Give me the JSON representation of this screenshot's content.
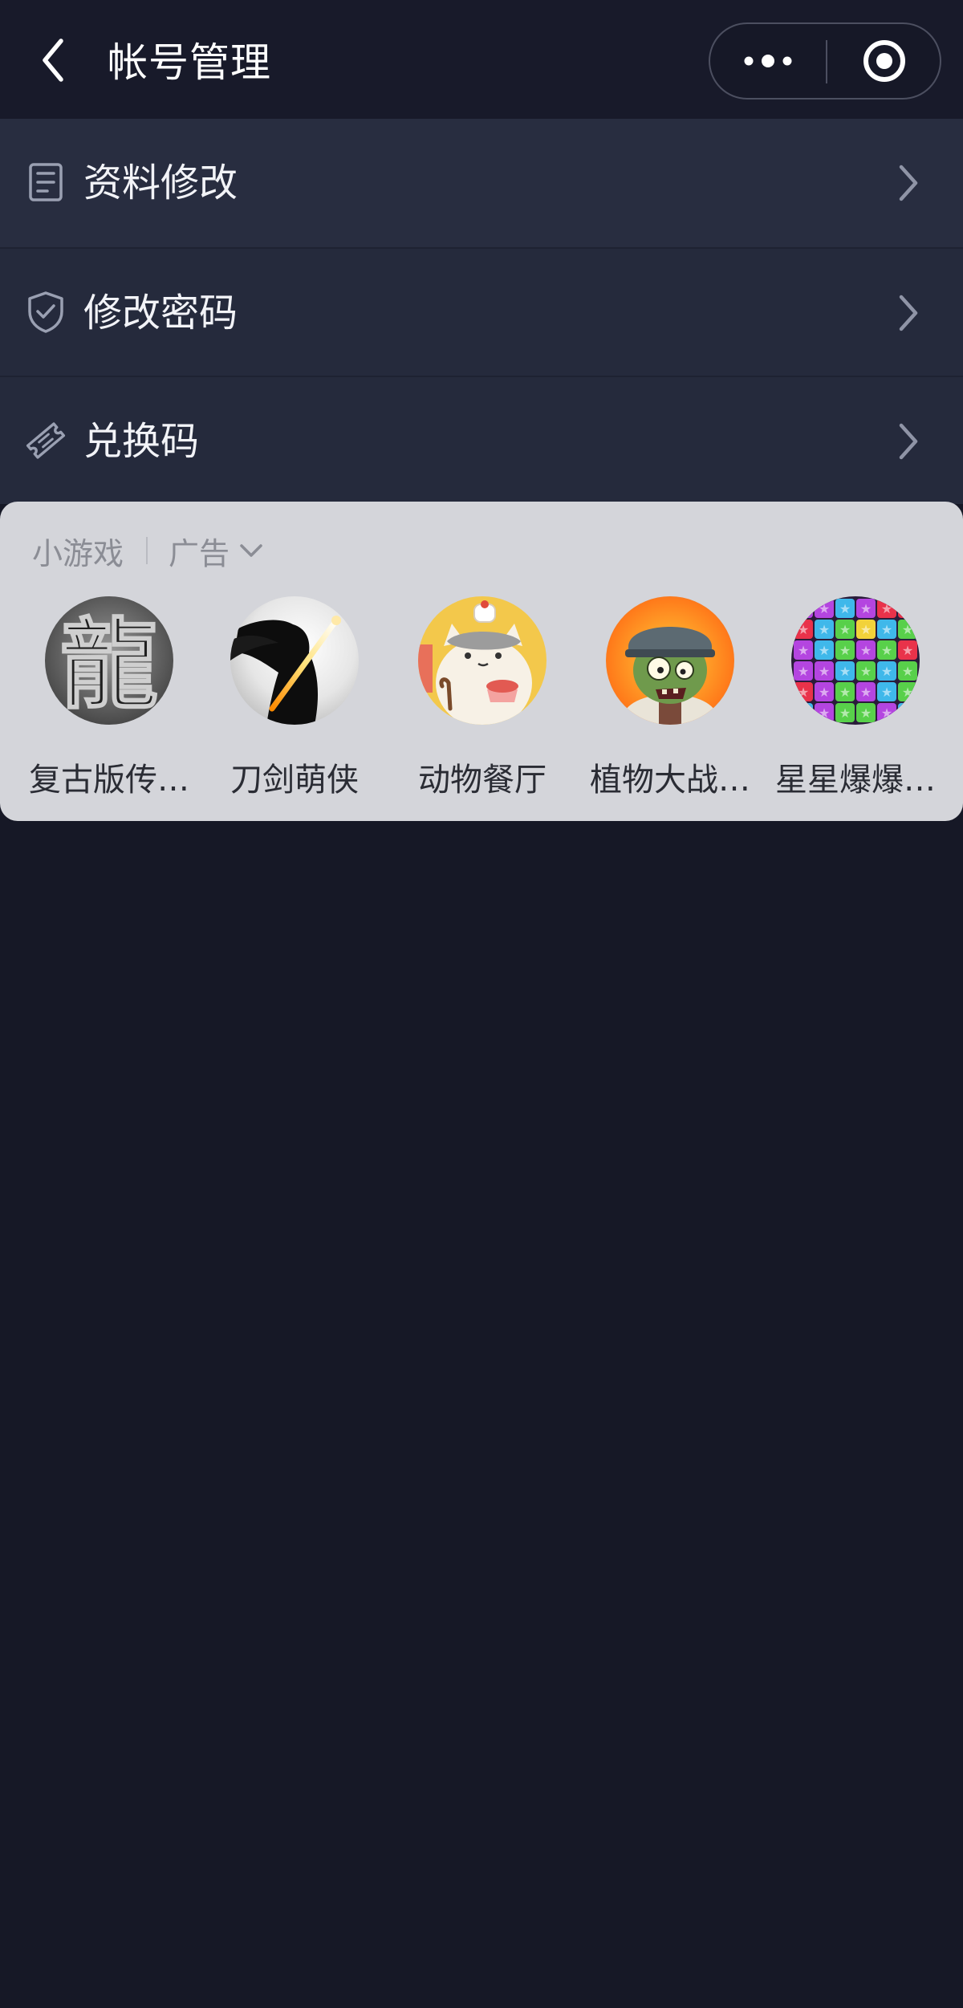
{
  "navbar": {
    "title": "帐号管理",
    "back_icon": "chevron-left-icon",
    "more_icon": "more-dots-icon",
    "close_icon": "record-circle-icon"
  },
  "menu": {
    "items": [
      {
        "label": "资料修改",
        "icon": "profile-form-icon"
      },
      {
        "label": "修改密码",
        "icon": "shield-check-icon"
      },
      {
        "label": "兑换码",
        "icon": "ticket-icon"
      }
    ]
  },
  "ad_panel": {
    "section_label": "小游戏",
    "ad_label": "广告",
    "games": [
      {
        "name": "复古版传…"
      },
      {
        "name": "刀剑萌侠"
      },
      {
        "name": "动物餐厅"
      },
      {
        "name": "植物大战…"
      },
      {
        "name": "星星爆爆…"
      }
    ],
    "game_0_glyph": "龍"
  },
  "colors": {
    "background": "#161826",
    "navbar": "#181a2a",
    "menu_item": "#252a3c",
    "ad_panel": "#d4d5da"
  }
}
